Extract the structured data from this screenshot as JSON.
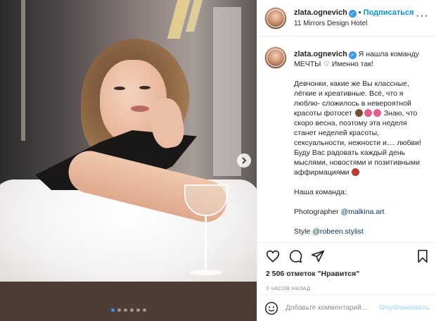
{
  "post": {
    "username": "zlata.ognevich",
    "follow_label": "Подписаться",
    "separator": "•",
    "location": "11 Mirrors Design Hotel",
    "more_label": "···",
    "carousel": {
      "total": 6,
      "active": 0
    }
  },
  "caption": {
    "username": "zlata.ognevich",
    "first_line": " Я нашла команду МЕЧТЫ ♡ Именно так!",
    "body_part1": "Девчонки, какие же Вы классные, лёгкие и креативные. Всё, что я люблю- сложилось в невероятной красоты фотосет",
    "body_part2": " Знаю, что скоро весна, поэтому эта неделя станет неделей красоты, сексуальности, нежности и.... любви! Буду Вас радовать каждый день мыслями, новостями и позитивными аффирмациями",
    "team_label": "Наша команда:",
    "photographer_label": "Photographer ",
    "photographer_handle": "@malkina.art",
    "style_label": "Style ",
    "style_handle": "@robeen.stylist"
  },
  "actions": {
    "likes": "2 506 отметок \"Нравится\"",
    "time": "3 часов назад"
  },
  "comment": {
    "placeholder": "Добавьте комментарий...",
    "post_label": "Опубликовать"
  },
  "colors": {
    "accent": "#0095f6",
    "verified": "#3897f0",
    "post_disabled": "#b2dffc"
  },
  "icons": [
    "heart-icon",
    "comment-icon",
    "share-icon",
    "bookmark-icon",
    "emoji-icon",
    "chevron-right-icon",
    "verified-icon",
    "more-icon"
  ]
}
